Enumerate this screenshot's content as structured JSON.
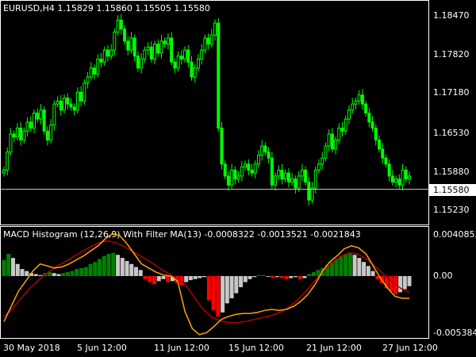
{
  "main": {
    "symbol_header": "EURUSD,H4  1.15829 1.15860 1.15505 1.15580",
    "price_scale": [
      "1.18470",
      "1.17820",
      "1.17180",
      "1.16530",
      "1.15880",
      "1.15230"
    ],
    "current_price": "1.15580",
    "colors": {
      "bull": "#00ff00",
      "bear": "#00ff00",
      "background": "#000000"
    }
  },
  "indicator": {
    "title": "MACD Histogram (12,26,9) With Filter MA(13) -0.0008322 -0.0013521 -0.0021843",
    "scale": [
      "0.0040853",
      "0.00",
      "-0.005384"
    ],
    "colors": {
      "hist_positive": "#008000",
      "hist_positive_fading": "#c8c8c8",
      "hist_negative": "#ff0000",
      "hist_negative_fading": "#c8c8c8",
      "macd_line": "#ffa500",
      "signal_line": "#b00000"
    }
  },
  "time_axis": [
    "30 May 2018",
    "5 Jun 12:00",
    "11 Jun 12:00",
    "15 Jun 12:00",
    "21 Jun 12:00",
    "27 Jun 12:00"
  ],
  "chart_data": {
    "type": "candlestick",
    "symbol": "EURUSD",
    "timeframe": "H4",
    "ylim": [
      1.1495,
      1.1875
    ],
    "x": [
      "30 May 2018",
      "5 Jun 12:00",
      "11 Jun 12:00",
      "15 Jun 12:00",
      "21 Jun 12:00",
      "27 Jun 12:00"
    ],
    "close_series": [
      1.159,
      1.162,
      1.165,
      1.1645,
      1.166,
      1.164,
      1.1655,
      1.167,
      1.166,
      1.1685,
      1.1675,
      1.169,
      1.1655,
      1.164,
      1.1665,
      1.17,
      1.1705,
      1.169,
      1.171,
      1.17,
      1.1695,
      1.169,
      1.172,
      1.1705,
      1.1735,
      1.1745,
      1.176,
      1.175,
      1.1775,
      1.177,
      1.179,
      1.178,
      1.179,
      1.182,
      1.184,
      1.1825,
      1.1805,
      1.179,
      1.181,
      1.178,
      1.176,
      1.1775,
      1.179,
      1.1795,
      1.1775,
      1.18,
      1.1785,
      1.1805,
      1.18,
      1.181,
      1.177,
      1.176,
      1.178,
      1.1775,
      1.179,
      1.177,
      1.1745,
      1.176,
      1.1775,
      1.179,
      1.181,
      1.18,
      1.1815,
      1.1835,
      1.166,
      1.16,
      1.158,
      1.1565,
      1.159,
      1.1575,
      1.158,
      1.1595,
      1.16,
      1.159,
      1.1585,
      1.16,
      1.1615,
      1.163,
      1.162,
      1.161,
      1.1565,
      1.158,
      1.159,
      1.1575,
      1.1585,
      1.157,
      1.1575,
      1.156,
      1.158,
      1.159,
      1.157,
      1.154,
      1.156,
      1.159,
      1.16,
      1.161,
      1.163,
      1.165,
      1.1625,
      1.164,
      1.166,
      1.1655,
      1.1675,
      1.169,
      1.17,
      1.1705,
      1.1715,
      1.17,
      1.1685,
      1.167,
      1.166,
      1.164,
      1.1625,
      1.161,
      1.16,
      1.158,
      1.157,
      1.1575,
      1.1565,
      1.159,
      1.1575,
      1.158
    ],
    "macd_histogram": [
      0.0016,
      0.0022,
      0.0018,
      0.0012,
      0.0007,
      0.0005,
      0.0003,
      0.0002,
      0.0001,
      0.0003,
      0.0004,
      0.0003,
      0.0002,
      0.0003,
      0.0004,
      0.0005,
      0.0007,
      0.0008,
      0.0009,
      0.0012,
      0.0014,
      0.0017,
      0.002,
      0.0022,
      0.0023,
      0.0021,
      0.0018,
      0.0015,
      0.0012,
      0.0009,
      0.0006,
      -0.0003,
      -0.0006,
      -0.0008,
      -0.0005,
      -0.0003,
      -0.0006,
      -0.0005,
      -0.0007,
      -0.0009,
      -0.0006,
      -0.0004,
      -0.0003,
      -0.0002,
      -0.0001,
      -0.0024,
      -0.0034,
      -0.004,
      -0.0036,
      -0.0027,
      -0.0022,
      -0.0017,
      -0.0011,
      -0.0006,
      -0.0003,
      -0.0001,
      0.0001,
      0.0001,
      0.0,
      -0.0002,
      -0.0001,
      -0.0002,
      -0.0003,
      -0.0002,
      -0.0001,
      -0.0003,
      -0.0002,
      0.0002,
      0.0004,
      0.0006,
      0.0008,
      0.0011,
      0.0014,
      0.0017,
      0.002,
      0.0022,
      0.0023,
      0.0021,
      0.0018,
      0.0014,
      0.001,
      0.0005,
      -0.0003,
      -0.0007,
      -0.0012,
      -0.0015,
      -0.0018,
      -0.0016,
      -0.0013,
      -0.001
    ],
    "macd_line": [
      -0.0045,
      -0.003,
      -0.0015,
      -0.0005,
      0.0005,
      0.0012,
      0.001,
      0.0008,
      0.0009,
      0.0012,
      0.0016,
      0.002,
      0.0025,
      0.003,
      0.0037,
      0.0042,
      0.004,
      0.0032,
      0.0022,
      0.0012,
      0.0008,
      0.0004,
      0.0001,
      0.0,
      -0.0005,
      -0.0035,
      -0.0052,
      -0.0058,
      -0.0056,
      -0.005,
      -0.0043,
      -0.004,
      -0.0038,
      -0.0037,
      -0.0037,
      -0.0036,
      -0.0034,
      -0.0033,
      -0.0034,
      -0.0033,
      -0.003,
      -0.0025,
      -0.0018,
      -0.0008,
      0.0005,
      0.0014,
      0.002,
      0.0027,
      0.003,
      0.0028,
      0.0022,
      0.001,
      -0.0002,
      -0.0012,
      -0.002,
      -0.0022,
      -0.0022
    ],
    "signal_line": [
      -0.004,
      -0.0032,
      -0.0022,
      -0.0012,
      -0.0004,
      0.0003,
      0.0009,
      0.0014,
      0.0019,
      0.0024,
      0.0029,
      0.0033,
      0.0035,
      0.0033,
      0.0029,
      0.0024,
      0.0019,
      0.0014,
      0.0008,
      0.0003,
      -0.0002,
      -0.0008,
      -0.002,
      -0.0032,
      -0.004,
      -0.0044,
      -0.0046,
      -0.0046,
      -0.0045,
      -0.0043,
      -0.0041,
      -0.0039,
      -0.0036,
      -0.0031,
      -0.0024,
      -0.0015,
      -0.0005,
      0.0005,
      0.0013,
      0.0019,
      0.0023,
      0.0022,
      0.0017,
      0.001,
      0.0002,
      -0.0006,
      -0.0012,
      -0.0016
    ]
  }
}
